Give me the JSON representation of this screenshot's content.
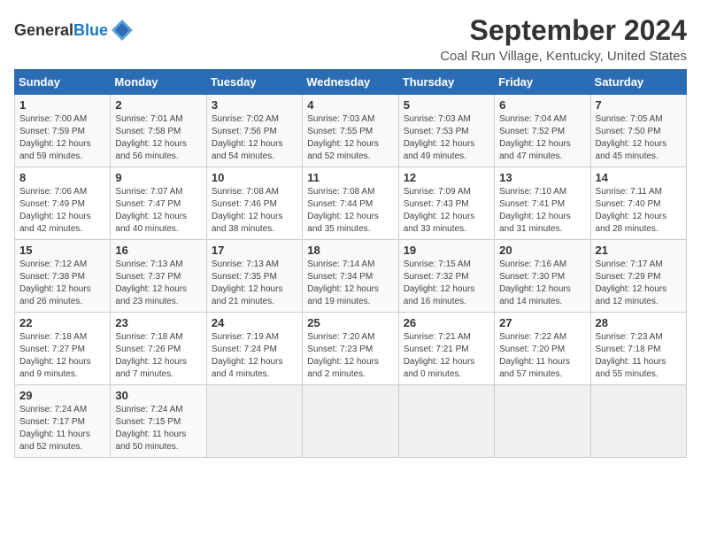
{
  "header": {
    "logo_general": "General",
    "logo_blue": "Blue",
    "title": "September 2024",
    "subtitle": "Coal Run Village, Kentucky, United States"
  },
  "days_of_week": [
    "Sunday",
    "Monday",
    "Tuesday",
    "Wednesday",
    "Thursday",
    "Friday",
    "Saturday"
  ],
  "weeks": [
    [
      {
        "day": "1",
        "sunrise": "7:00 AM",
        "sunset": "7:59 PM",
        "daylight": "12 hours and 59 minutes."
      },
      {
        "day": "2",
        "sunrise": "7:01 AM",
        "sunset": "7:58 PM",
        "daylight": "12 hours and 56 minutes."
      },
      {
        "day": "3",
        "sunrise": "7:02 AM",
        "sunset": "7:56 PM",
        "daylight": "12 hours and 54 minutes."
      },
      {
        "day": "4",
        "sunrise": "7:03 AM",
        "sunset": "7:55 PM",
        "daylight": "12 hours and 52 minutes."
      },
      {
        "day": "5",
        "sunrise": "7:03 AM",
        "sunset": "7:53 PM",
        "daylight": "12 hours and 49 minutes."
      },
      {
        "day": "6",
        "sunrise": "7:04 AM",
        "sunset": "7:52 PM",
        "daylight": "12 hours and 47 minutes."
      },
      {
        "day": "7",
        "sunrise": "7:05 AM",
        "sunset": "7:50 PM",
        "daylight": "12 hours and 45 minutes."
      }
    ],
    [
      {
        "day": "8",
        "sunrise": "7:06 AM",
        "sunset": "7:49 PM",
        "daylight": "12 hours and 42 minutes."
      },
      {
        "day": "9",
        "sunrise": "7:07 AM",
        "sunset": "7:47 PM",
        "daylight": "12 hours and 40 minutes."
      },
      {
        "day": "10",
        "sunrise": "7:08 AM",
        "sunset": "7:46 PM",
        "daylight": "12 hours and 38 minutes."
      },
      {
        "day": "11",
        "sunrise": "7:08 AM",
        "sunset": "7:44 PM",
        "daylight": "12 hours and 35 minutes."
      },
      {
        "day": "12",
        "sunrise": "7:09 AM",
        "sunset": "7:43 PM",
        "daylight": "12 hours and 33 minutes."
      },
      {
        "day": "13",
        "sunrise": "7:10 AM",
        "sunset": "7:41 PM",
        "daylight": "12 hours and 31 minutes."
      },
      {
        "day": "14",
        "sunrise": "7:11 AM",
        "sunset": "7:40 PM",
        "daylight": "12 hours and 28 minutes."
      }
    ],
    [
      {
        "day": "15",
        "sunrise": "7:12 AM",
        "sunset": "7:38 PM",
        "daylight": "12 hours and 26 minutes."
      },
      {
        "day": "16",
        "sunrise": "7:13 AM",
        "sunset": "7:37 PM",
        "daylight": "12 hours and 23 minutes."
      },
      {
        "day": "17",
        "sunrise": "7:13 AM",
        "sunset": "7:35 PM",
        "daylight": "12 hours and 21 minutes."
      },
      {
        "day": "18",
        "sunrise": "7:14 AM",
        "sunset": "7:34 PM",
        "daylight": "12 hours and 19 minutes."
      },
      {
        "day": "19",
        "sunrise": "7:15 AM",
        "sunset": "7:32 PM",
        "daylight": "12 hours and 16 minutes."
      },
      {
        "day": "20",
        "sunrise": "7:16 AM",
        "sunset": "7:30 PM",
        "daylight": "12 hours and 14 minutes."
      },
      {
        "day": "21",
        "sunrise": "7:17 AM",
        "sunset": "7:29 PM",
        "daylight": "12 hours and 12 minutes."
      }
    ],
    [
      {
        "day": "22",
        "sunrise": "7:18 AM",
        "sunset": "7:27 PM",
        "daylight": "12 hours and 9 minutes."
      },
      {
        "day": "23",
        "sunrise": "7:18 AM",
        "sunset": "7:26 PM",
        "daylight": "12 hours and 7 minutes."
      },
      {
        "day": "24",
        "sunrise": "7:19 AM",
        "sunset": "7:24 PM",
        "daylight": "12 hours and 4 minutes."
      },
      {
        "day": "25",
        "sunrise": "7:20 AM",
        "sunset": "7:23 PM",
        "daylight": "12 hours and 2 minutes."
      },
      {
        "day": "26",
        "sunrise": "7:21 AM",
        "sunset": "7:21 PM",
        "daylight": "12 hours and 0 minutes."
      },
      {
        "day": "27",
        "sunrise": "7:22 AM",
        "sunset": "7:20 PM",
        "daylight": "11 hours and 57 minutes."
      },
      {
        "day": "28",
        "sunrise": "7:23 AM",
        "sunset": "7:18 PM",
        "daylight": "11 hours and 55 minutes."
      }
    ],
    [
      {
        "day": "29",
        "sunrise": "7:24 AM",
        "sunset": "7:17 PM",
        "daylight": "11 hours and 52 minutes."
      },
      {
        "day": "30",
        "sunrise": "7:24 AM",
        "sunset": "7:15 PM",
        "daylight": "11 hours and 50 minutes."
      },
      null,
      null,
      null,
      null,
      null
    ]
  ]
}
